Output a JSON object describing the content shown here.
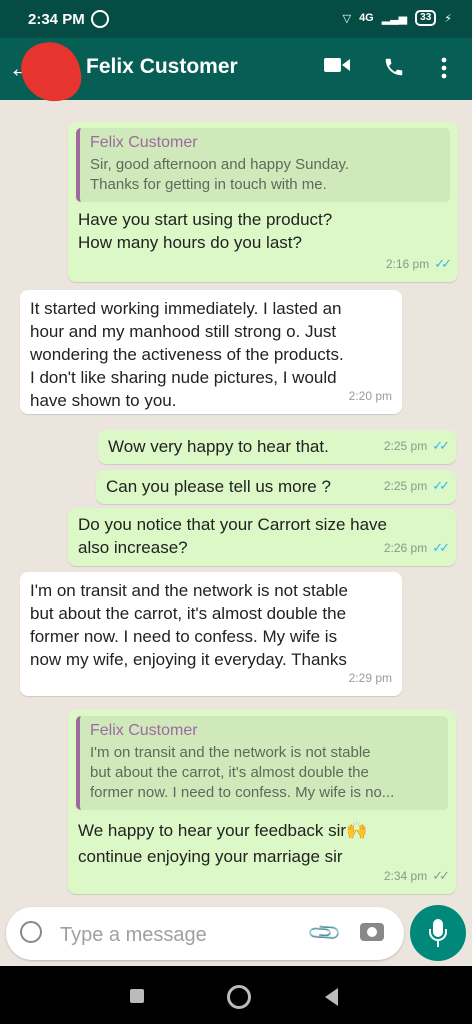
{
  "status": {
    "time": "2:34 PM",
    "network": "4G",
    "battery": "33"
  },
  "header": {
    "title": "Felix Customer"
  },
  "messages": [
    {
      "time": "2:16 pm",
      "quote_name": "Felix Customer",
      "quote_line1": "Sir, good afternoon and happy Sunday.",
      "quote_line2": "Thanks for getting in touch with me.",
      "line1": "Have you start using the product?",
      "line2": "How many hours do you last?"
    },
    {
      "time": "2:20 pm",
      "line1": "It started working immediately. I lasted an",
      "line2": "hour and my manhood still strong o. Just",
      "line3": "wondering the activeness of the products.",
      "line4": "I don't like sharing nude pictures, I would",
      "line5": "have shown to you."
    },
    {
      "time": "2:25 pm",
      "line1": "Wow very happy to hear that."
    },
    {
      "time": "2:25 pm",
      "line1": "Can you please tell us more ?"
    },
    {
      "time": "2:26 pm",
      "line1": "Do you notice that your Carrort size have",
      "line2": "also increase?"
    },
    {
      "time": "2:29 pm",
      "line1": "I'm on transit and the network is not stable",
      "line2": "but about the carrot, it's almost double the",
      "line3": "former now. I need to confess. My wife is",
      "line4": "now my wife, enjoying it everyday. Thanks"
    },
    {
      "time": "2:34 pm",
      "quote_name": "Felix Customer",
      "quote_line1": "I'm on transit and the network is not stable",
      "quote_line2": "but about the carrot, it's almost double the",
      "quote_line3": "former now. I need to confess. My wife is no...",
      "line1": "We happy to hear your feedback sir🙌",
      "line2": "continue enjoying your marriage sir"
    }
  ],
  "composer": {
    "placeholder": "Type a message"
  },
  "colors": {
    "header": "#075e54",
    "outgoing": "#dcf8c6",
    "incoming": "#ffffff",
    "read_ticks": "#34b7f1"
  }
}
